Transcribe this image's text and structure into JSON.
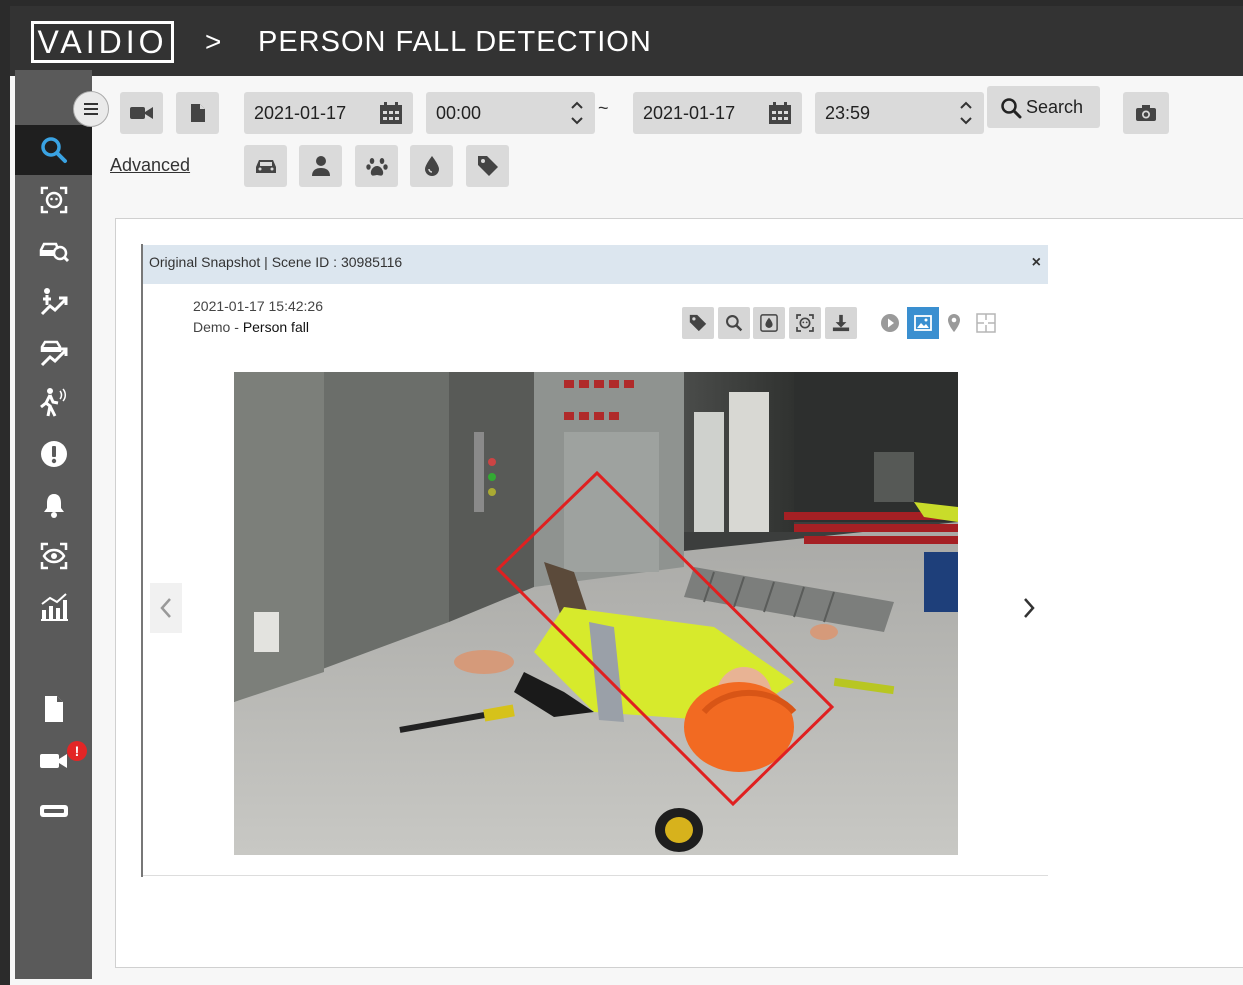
{
  "header": {
    "logo_text": "VAIDIO",
    "separator": ">",
    "page_title": "PERSON FALL DETECTION"
  },
  "sidebar": {
    "items": [
      {
        "icon": "search-icon",
        "active": true
      },
      {
        "icon": "face-scan-icon"
      },
      {
        "icon": "vehicle-search-icon"
      },
      {
        "icon": "person-trend-icon"
      },
      {
        "icon": "vehicle-trend-icon"
      },
      {
        "icon": "intrusion-icon"
      },
      {
        "icon": "alert-icon"
      },
      {
        "icon": "bell-icon"
      },
      {
        "icon": "eye-scan-icon"
      },
      {
        "icon": "analytics-icon"
      },
      {
        "icon": "document-icon"
      },
      {
        "icon": "camera-icon",
        "badge": "!"
      },
      {
        "icon": "server-icon"
      }
    ]
  },
  "toolbar": {
    "start_date": "2021-01-17",
    "start_time": "00:00",
    "range_separator": "~",
    "end_date": "2021-01-17",
    "end_time": "23:59",
    "search_label": "Search",
    "advanced_label": "Advanced",
    "filters": [
      "car-icon",
      "person-icon",
      "paw-icon",
      "drop-icon",
      "tag-icon"
    ]
  },
  "snapshot_card": {
    "title": "Original Snapshot | Scene ID : 30985116",
    "close": "×",
    "timestamp": "2021-01-17 15:42:26",
    "camera": "Demo",
    "camera_separator": " - ",
    "event": "Person fall"
  },
  "colors": {
    "topbar": "#333333",
    "sidebar": "#5a5a5a",
    "sidebar_active": "#1f1f1f",
    "detection_box": "#e02020",
    "active_view": "#3a8fd0",
    "badge": "#e32626"
  }
}
